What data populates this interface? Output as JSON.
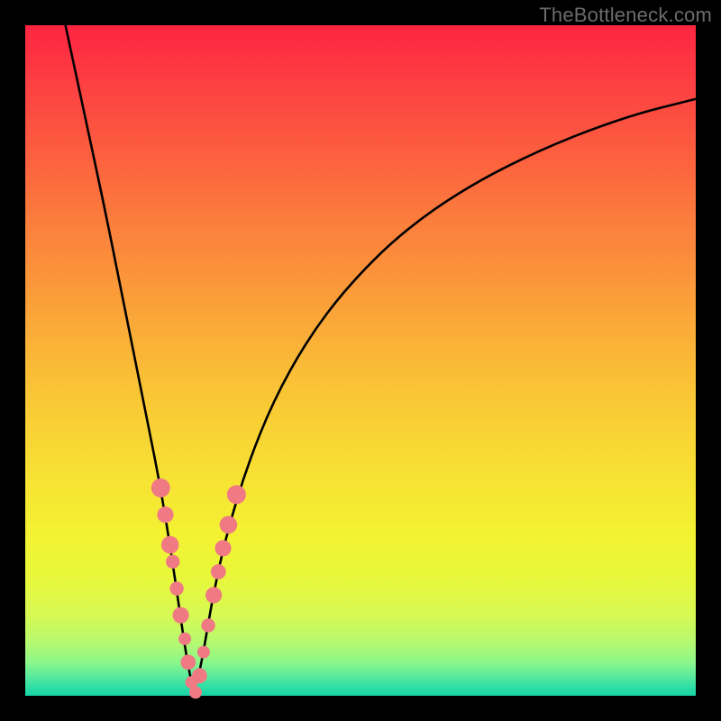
{
  "watermark": "TheBottleneck.com",
  "colors": {
    "background_frame": "#000000",
    "point_fill": "#f07a84",
    "curve_stroke": "#000000",
    "gradient_top": "#fd2541",
    "gradient_bottom": "#16d5a6"
  },
  "chart_data": {
    "type": "line",
    "title": "",
    "xlabel": "",
    "ylabel": "",
    "xlim": [
      0,
      100
    ],
    "ylim": [
      0,
      100
    ],
    "grid": false,
    "annotations": [
      "TheBottleneck.com"
    ],
    "curve": {
      "description": "V-shaped bottleneck curve with sharp notch near x≈25 and asymptotic rise toward both x extremes",
      "min_x": 25.2,
      "min_y": 0,
      "points_on_curve": [
        {
          "x": 6.0,
          "y": 100.0
        },
        {
          "x": 9.0,
          "y": 86.0
        },
        {
          "x": 12.0,
          "y": 72.0
        },
        {
          "x": 15.0,
          "y": 57.0
        },
        {
          "x": 18.0,
          "y": 42.0
        },
        {
          "x": 20.0,
          "y": 32.0
        },
        {
          "x": 21.5,
          "y": 23.0
        },
        {
          "x": 23.0,
          "y": 13.0
        },
        {
          "x": 24.0,
          "y": 6.0
        },
        {
          "x": 25.2,
          "y": 0.0
        },
        {
          "x": 26.5,
          "y": 6.0
        },
        {
          "x": 28.0,
          "y": 15.0
        },
        {
          "x": 30.0,
          "y": 24.0
        },
        {
          "x": 33.0,
          "y": 34.0
        },
        {
          "x": 37.0,
          "y": 44.0
        },
        {
          "x": 42.0,
          "y": 53.0
        },
        {
          "x": 48.0,
          "y": 61.0
        },
        {
          "x": 56.0,
          "y": 69.0
        },
        {
          "x": 66.0,
          "y": 76.0
        },
        {
          "x": 78.0,
          "y": 82.0
        },
        {
          "x": 90.0,
          "y": 86.5
        },
        {
          "x": 100.0,
          "y": 89.0
        }
      ]
    },
    "series": [
      {
        "name": "highlighted-data-points",
        "description": "Salmon-colored markers clustered along both arms of the V near the bottom",
        "points": [
          {
            "x": 20.2,
            "y": 31.0,
            "r": 1.5
          },
          {
            "x": 20.9,
            "y": 27.0,
            "r": 1.3
          },
          {
            "x": 21.6,
            "y": 22.5,
            "r": 1.4
          },
          {
            "x": 22.0,
            "y": 20.0,
            "r": 1.1
          },
          {
            "x": 22.6,
            "y": 16.0,
            "r": 1.1
          },
          {
            "x": 23.2,
            "y": 12.0,
            "r": 1.3
          },
          {
            "x": 23.8,
            "y": 8.5,
            "r": 1.0
          },
          {
            "x": 24.3,
            "y": 5.0,
            "r": 1.2
          },
          {
            "x": 24.8,
            "y": 2.0,
            "r": 1.0
          },
          {
            "x": 25.4,
            "y": 0.5,
            "r": 1.0
          },
          {
            "x": 26.0,
            "y": 3.0,
            "r": 1.2
          },
          {
            "x": 26.6,
            "y": 6.5,
            "r": 1.0
          },
          {
            "x": 27.3,
            "y": 10.5,
            "r": 1.1
          },
          {
            "x": 28.1,
            "y": 15.0,
            "r": 1.3
          },
          {
            "x": 28.8,
            "y": 18.5,
            "r": 1.2
          },
          {
            "x": 29.5,
            "y": 22.0,
            "r": 1.3
          },
          {
            "x": 30.3,
            "y": 25.5,
            "r": 1.4
          },
          {
            "x": 31.5,
            "y": 30.0,
            "r": 1.5
          }
        ]
      }
    ]
  }
}
